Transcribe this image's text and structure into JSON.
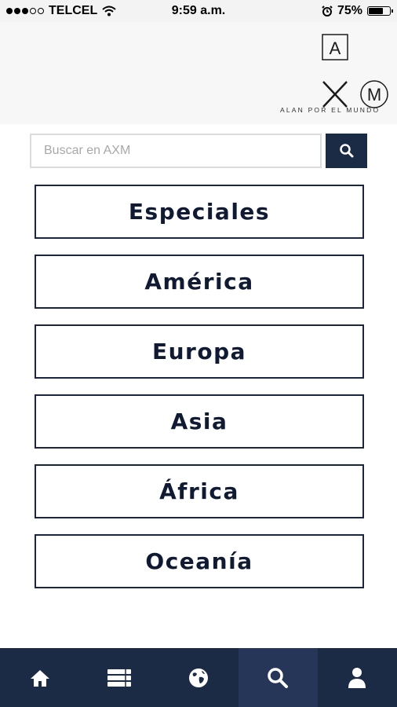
{
  "status_bar": {
    "carrier": "TELCEL",
    "time": "9:59 a.m.",
    "battery": "75%",
    "battery_level": 0.75,
    "signal_bars_filled": 3,
    "signal_bars_total": 5
  },
  "header": {
    "logo_letter_a": "A",
    "logo_letter_x": "X",
    "logo_letter_m": "M",
    "tagline": "ALAN POR EL MUNDO"
  },
  "search": {
    "placeholder": "Buscar en AXM",
    "value": ""
  },
  "categories": [
    {
      "label": "Especiales"
    },
    {
      "label": "América"
    },
    {
      "label": "Europa"
    },
    {
      "label": "Asia"
    },
    {
      "label": "África"
    },
    {
      "label": "Oceanía"
    }
  ],
  "bottom_nav": {
    "items": [
      {
        "icon": "home-icon"
      },
      {
        "icon": "list-icon"
      },
      {
        "icon": "globe-icon"
      },
      {
        "icon": "search-icon",
        "active": true
      },
      {
        "icon": "user-icon"
      }
    ]
  },
  "colors": {
    "navy": "#1b2a45",
    "nav_active": "#253658",
    "header_bg": "#f7f7f7"
  }
}
